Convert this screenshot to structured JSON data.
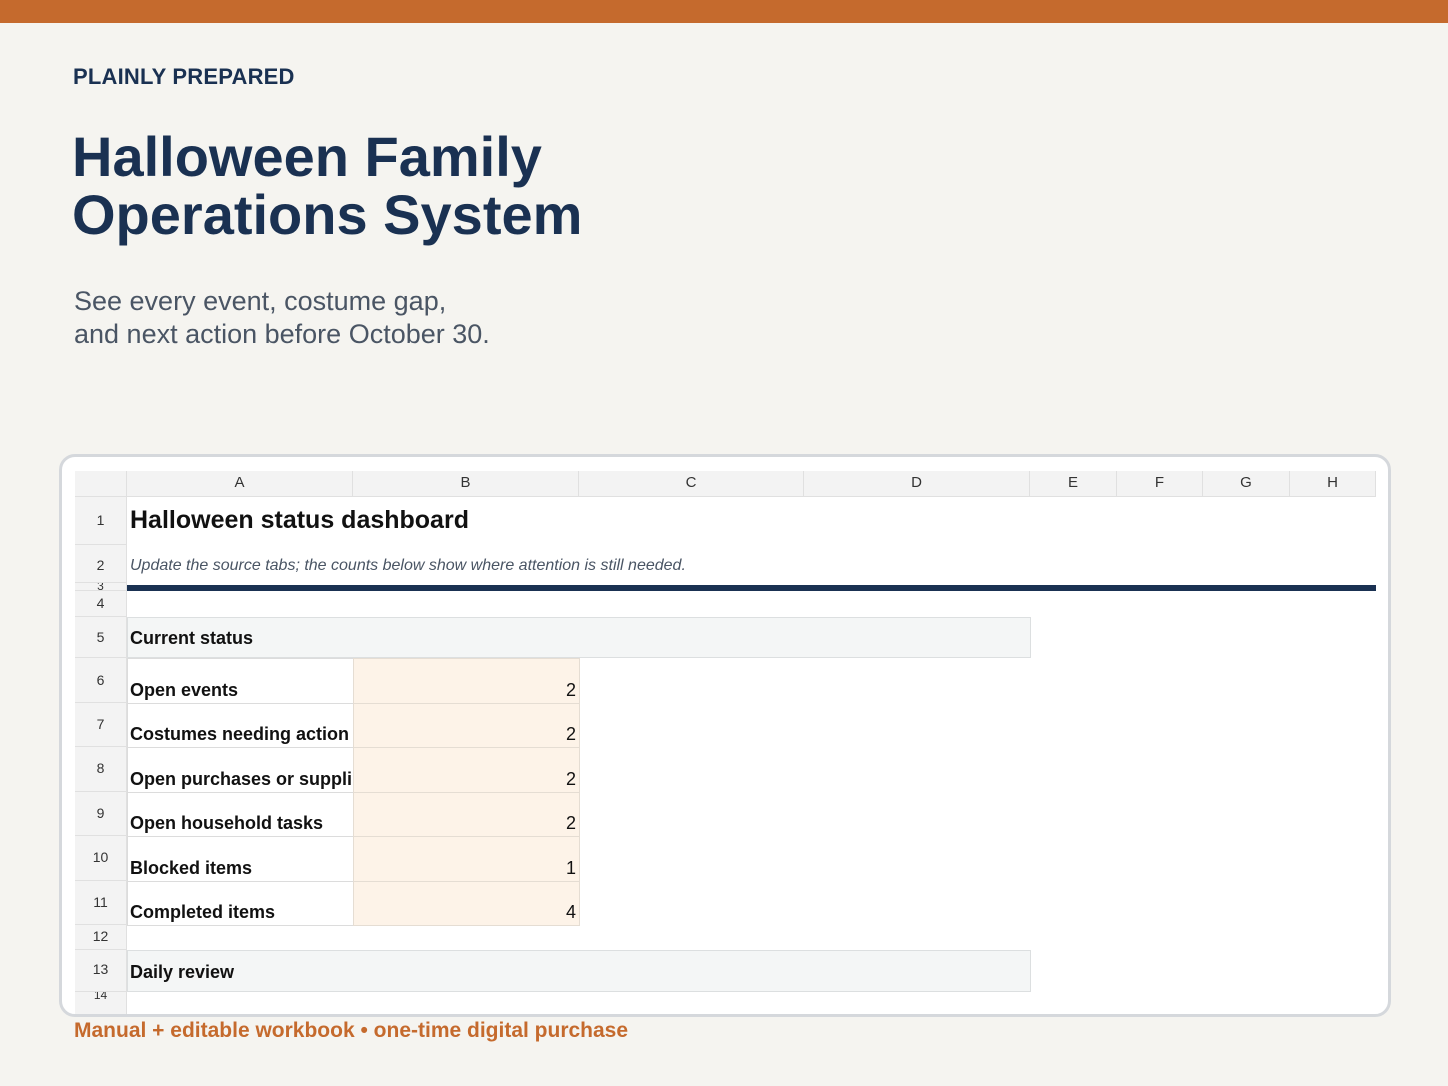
{
  "brand": "PLAINLY PREPARED",
  "title_line1": "Halloween Family",
  "title_line2": "Operations System",
  "subtitle_line1": "See every event, costume gap,",
  "subtitle_line2": "and next action before October 30.",
  "footer": "Manual + editable workbook • one-time digital purchase",
  "colors": {
    "accent": "#c56a2d",
    "navy": "#1a3152",
    "value_fill": "#fdf3e8",
    "band_fill": "#f4f6f6"
  },
  "sheet": {
    "columns": [
      "A",
      "B",
      "C",
      "D",
      "E",
      "F",
      "G",
      "H"
    ],
    "rows": [
      "1",
      "2",
      "3",
      "4",
      "5",
      "6",
      "7",
      "8",
      "9",
      "10",
      "11",
      "12",
      "13",
      "14"
    ],
    "dashboard_title": "Halloween status dashboard",
    "dashboard_note": "Update the source tabs; the counts below show where attention is still needed.",
    "current_status_header": "Current status",
    "status_items": [
      {
        "label": "Open events",
        "value": "2"
      },
      {
        "label": "Costumes needing action",
        "value": "2"
      },
      {
        "label": "Open purchases or supplies",
        "value": "2"
      },
      {
        "label": "Open household tasks",
        "value": "2"
      },
      {
        "label": "Blocked items",
        "value": "1"
      },
      {
        "label": "Completed items",
        "value": "4"
      }
    ],
    "daily_review_header": "Daily review"
  }
}
